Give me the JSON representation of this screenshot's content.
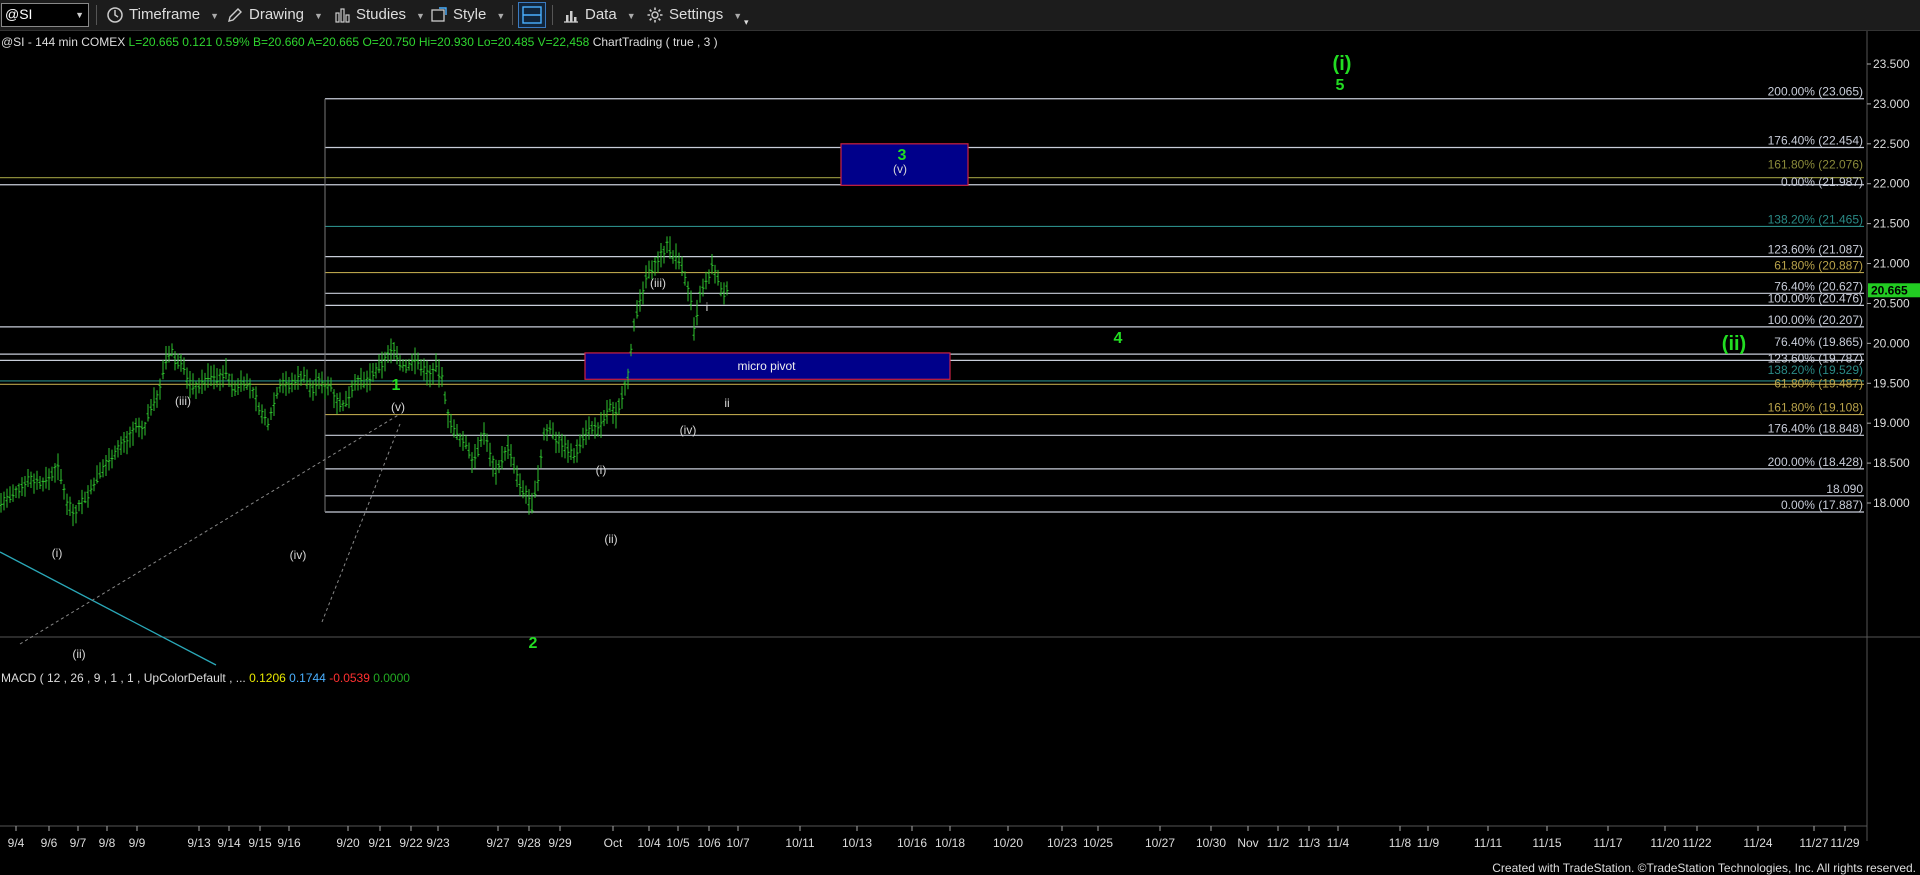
{
  "toolbar": {
    "symbol": "@SI",
    "timeframe": "Timeframe",
    "drawing": "Drawing",
    "studies": "Studies",
    "style": "Style",
    "data": "Data",
    "settings": "Settings"
  },
  "footer": {
    "credit": "Created with TradeStation. ©TradeStation Technologies, Inc. All rights reserved."
  },
  "chart_data": {
    "type": "candlestick",
    "header": {
      "symbol": "@SI - 144 min COMEX",
      "fields": [
        {
          "label": "L=",
          "value": "20.665"
        },
        {
          "label": "",
          "value": "0.121"
        },
        {
          "label": "",
          "value": "0.59%"
        },
        {
          "label": "B=",
          "value": "20.660"
        },
        {
          "label": "A=",
          "value": "20.665"
        },
        {
          "label": "O=",
          "value": "20.750"
        },
        {
          "label": "Hi=",
          "value": "20.930"
        },
        {
          "label": "Lo=",
          "value": "20.485"
        },
        {
          "label": "V=",
          "value": "22,458"
        },
        {
          "label": "",
          "value": "ChartTrading ( true , 3 )"
        }
      ]
    },
    "last_price": "20.665",
    "ylim": [
      17.5,
      23.75
    ],
    "ticks": [
      "18.000",
      "18.500",
      "19.000",
      "19.500",
      "20.000",
      "20.500",
      "21.000",
      "21.500",
      "22.000",
      "22.500",
      "23.000",
      "23.500"
    ],
    "dates": [
      "9/4",
      "9/6",
      "9/7",
      "9/8",
      "9/9",
      "9/13",
      "9/14",
      "9/15",
      "9/16",
      "9/20",
      "9/21",
      "9/22",
      "9/23",
      "9/27",
      "9/28",
      "9/29",
      "Oct",
      "10/4",
      "10/5",
      "10/6",
      "10/7",
      "10/11",
      "10/13",
      "10/16",
      "10/18",
      "10/20",
      "10/23",
      "10/25",
      "10/27",
      "10/30",
      "Nov",
      "11/2",
      "11/3",
      "11/4",
      "11/8",
      "11/9",
      "11/11",
      "11/15",
      "11/17",
      "11/20",
      "11/22",
      "11/24",
      "11/27",
      "11/29"
    ],
    "fib_levels": [
      {
        "label": "200.00% (23.065)",
        "value": 23.065,
        "color": "#c8cdd9"
      },
      {
        "label": "176.40% (22.454)",
        "value": 22.454,
        "color": "#c8cdd9"
      },
      {
        "label": "161.80% (22.076)",
        "value": 22.076,
        "color": "#8a8a3a"
      },
      {
        "label": "0.00% (21.987)",
        "value": 21.987,
        "color": "#c8cdd9"
      },
      {
        "label": "138.20% (21.465)",
        "value": 21.465,
        "color": "#2a8a86"
      },
      {
        "label": "123.60% (21.087)",
        "value": 21.087,
        "color": "#c8cdd9"
      },
      {
        "label": "61.80% (20.887)",
        "value": 20.887,
        "color": "#b8a24a"
      },
      {
        "label": "76.40% (20.627)",
        "value": 20.627,
        "color": "#c8cdd9"
      },
      {
        "label": "100.00% (20.476)",
        "value": 20.476,
        "color": "#c8cdd9"
      },
      {
        "label": "100.00% (20.207)",
        "value": 20.207,
        "color": "#c8cdd9"
      },
      {
        "label": "76.40% (19.865)",
        "value": 19.865,
        "color": "#c8cdd9"
      },
      {
        "label": "123.60% (19.787)",
        "value": 19.787,
        "color": "#c8cdd9"
      },
      {
        "label": "138.20% (19.529)",
        "value": 19.529,
        "color": "#2a8a86"
      },
      {
        "label": "61.80% (19.487)",
        "value": 19.487,
        "color": "#b8a24a"
      },
      {
        "label": "161.80% (19.108)",
        "value": 19.108,
        "color": "#b8a24a"
      },
      {
        "label": "176.40% (18.848)",
        "value": 18.848,
        "color": "#c8cdd9"
      },
      {
        "label": "200.00% (18.428)",
        "value": 18.428,
        "color": "#c8cdd9"
      },
      {
        "label": "18.090",
        "value": 18.09,
        "color": "#c8cdd9"
      },
      {
        "label": "0.00% (17.887)",
        "value": 17.887,
        "color": "#c8cdd9"
      }
    ],
    "boxes": [
      {
        "label": "",
        "price_high": 22.5,
        "price_low": 21.98
      },
      {
        "label": "micro pivot",
        "price_high": 19.88,
        "price_low": 19.55
      }
    ],
    "wave_labels": [
      {
        "text": "(i)",
        "color": "#d8d8d8"
      },
      {
        "text": "(ii)",
        "color": "#d8d8d8"
      },
      {
        "text": "(iii)",
        "color": "#d8d8d8"
      },
      {
        "text": "(iv)",
        "color": "#d8d8d8"
      },
      {
        "text": "(v)",
        "color": "#d8d8d8"
      },
      {
        "text": "1",
        "color": "#22dd22"
      },
      {
        "text": "2",
        "color": "#22dd22"
      },
      {
        "text": "(i)",
        "color": "#d8d8d8"
      },
      {
        "text": "(ii)",
        "color": "#d8d8d8"
      },
      {
        "text": "(iii)",
        "color": "#d8d8d8"
      },
      {
        "text": "(iv)",
        "color": "#d8d8d8"
      },
      {
        "text": "i",
        "color": "#d8d8d8"
      },
      {
        "text": "ii",
        "color": "#d8d8d8"
      },
      {
        "text": "3",
        "color": "#22dd22"
      },
      {
        "text": "(v)",
        "color": "#d8d8d8"
      },
      {
        "text": "4",
        "color": "#22dd22"
      },
      {
        "text": "(i)",
        "color": "#22dd22"
      },
      {
        "text": "5",
        "color": "#22dd22"
      },
      {
        "text": "(ii)",
        "color": "#22dd22"
      }
    ],
    "indicator": {
      "label": "MACD ( 12 , 26 , 9 , 1 , 1 , UpColorDefault , ...",
      "values": [
        {
          "text": "0.1206",
          "color": "#e8e800"
        },
        {
          "text": "0.1744",
          "color": "#4ab0ff"
        },
        {
          "text": "-0.0539",
          "color": "#ff3030"
        },
        {
          "text": "0.0000",
          "color": "#22aa22"
        }
      ]
    },
    "price_path": [
      [
        0,
        18.0
      ],
      [
        14,
        18.1
      ],
      [
        28,
        18.3
      ],
      [
        44,
        18.25
      ],
      [
        58,
        18.45
      ],
      [
        66,
        18.05
      ],
      [
        74,
        17.85
      ],
      [
        80,
        18.0
      ],
      [
        88,
        18.1
      ],
      [
        96,
        18.3
      ],
      [
        104,
        18.45
      ],
      [
        112,
        18.6
      ],
      [
        120,
        18.7
      ],
      [
        128,
        18.8
      ],
      [
        136,
        18.95
      ],
      [
        144,
        18.9
      ],
      [
        150,
        19.2
      ],
      [
        158,
        19.35
      ],
      [
        166,
        19.8
      ],
      [
        172,
        19.9
      ],
      [
        176,
        19.75
      ],
      [
        182,
        19.8
      ],
      [
        188,
        19.5
      ],
      [
        196,
        19.45
      ],
      [
        202,
        19.5
      ],
      [
        210,
        19.6
      ],
      [
        218,
        19.55
      ],
      [
        226,
        19.65
      ],
      [
        234,
        19.4
      ],
      [
        242,
        19.55
      ],
      [
        250,
        19.45
      ],
      [
        256,
        19.3
      ],
      [
        262,
        19.1
      ],
      [
        268,
        19.0
      ],
      [
        276,
        19.35
      ],
      [
        282,
        19.55
      ],
      [
        288,
        19.45
      ],
      [
        296,
        19.55
      ],
      [
        304,
        19.6
      ],
      [
        312,
        19.4
      ],
      [
        318,
        19.55
      ],
      [
        324,
        19.45
      ],
      [
        330,
        19.5
      ],
      [
        336,
        19.3
      ],
      [
        344,
        19.2
      ],
      [
        350,
        19.4
      ],
      [
        356,
        19.55
      ],
      [
        364,
        19.5
      ],
      [
        372,
        19.6
      ],
      [
        380,
        19.7
      ],
      [
        388,
        19.85
      ],
      [
        394,
        19.95
      ],
      [
        400,
        19.75
      ],
      [
        406,
        19.7
      ],
      [
        414,
        19.8
      ],
      [
        422,
        19.7
      ],
      [
        430,
        19.6
      ],
      [
        436,
        19.7
      ],
      [
        442,
        19.55
      ],
      [
        448,
        19.1
      ],
      [
        454,
        18.9
      ],
      [
        460,
        18.8
      ],
      [
        466,
        18.75
      ],
      [
        472,
        18.55
      ],
      [
        478,
        18.65
      ],
      [
        484,
        18.9
      ],
      [
        490,
        18.6
      ],
      [
        496,
        18.4
      ],
      [
        502,
        18.55
      ],
      [
        508,
        18.7
      ],
      [
        514,
        18.45
      ],
      [
        520,
        18.2
      ],
      [
        526,
        18.1
      ],
      [
        532,
        17.95
      ],
      [
        538,
        18.3
      ],
      [
        544,
        18.85
      ],
      [
        550,
        18.95
      ],
      [
        556,
        18.8
      ],
      [
        562,
        18.75
      ],
      [
        568,
        18.65
      ],
      [
        574,
        18.6
      ],
      [
        580,
        18.75
      ],
      [
        586,
        18.9
      ],
      [
        592,
        18.95
      ],
      [
        598,
        18.9
      ],
      [
        604,
        19.05
      ],
      [
        610,
        19.2
      ],
      [
        616,
        19.1
      ],
      [
        622,
        19.35
      ],
      [
        628,
        19.6
      ],
      [
        634,
        20.25
      ],
      [
        640,
        20.5
      ],
      [
        646,
        20.8
      ],
      [
        652,
        20.95
      ],
      [
        658,
        21.05
      ],
      [
        664,
        21.15
      ],
      [
        668,
        21.3
      ],
      [
        672,
        21.05
      ],
      [
        678,
        21.1
      ],
      [
        684,
        20.85
      ],
      [
        690,
        20.6
      ],
      [
        694,
        20.15
      ],
      [
        700,
        20.6
      ],
      [
        706,
        20.75
      ],
      [
        712,
        20.95
      ],
      [
        718,
        20.8
      ],
      [
        722,
        20.6
      ],
      [
        728,
        20.7
      ]
    ]
  }
}
